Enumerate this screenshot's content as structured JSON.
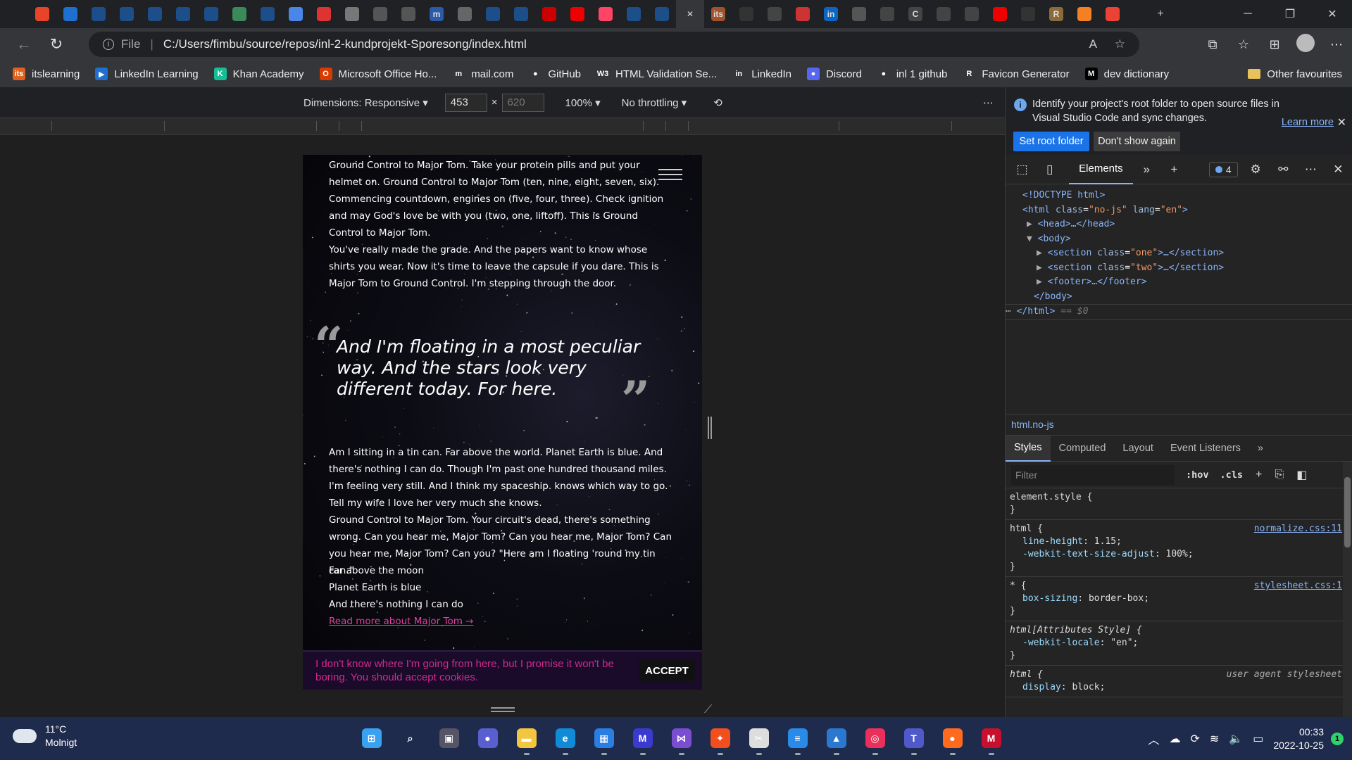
{
  "browser": {
    "tabs": [
      {
        "icon": "tab-actions-icon",
        "label": "",
        "color": "#202124"
      },
      {
        "icon": "office-icon",
        "label": "",
        "color": "#e8442a"
      },
      {
        "icon": "outlook-icon",
        "label": "",
        "color": "#1f6fd0"
      },
      {
        "icon": "video-icon",
        "label": "",
        "color": "#1c4e8a"
      },
      {
        "icon": "video-icon",
        "label": "",
        "color": "#1c4e8a"
      },
      {
        "icon": "video-icon",
        "label": "",
        "color": "#1c4e8a"
      },
      {
        "icon": "video-icon",
        "label": "",
        "color": "#1c4e8a"
      },
      {
        "icon": "video-icon",
        "label": "",
        "color": "#1c4e8a"
      },
      {
        "icon": "shield-icon",
        "label": "",
        "color": "#3a8a5a"
      },
      {
        "icon": "video-icon",
        "label": "",
        "color": "#1c4e8a"
      },
      {
        "icon": "docs-icon",
        "label": "",
        "color": "#4a86e8"
      },
      {
        "icon": "extension-icon",
        "label": "",
        "color": "#d33"
      },
      {
        "icon": "screenshot-icon",
        "label": "",
        "color": "#777"
      },
      {
        "icon": "extension-icon",
        "label": "",
        "color": "#555"
      },
      {
        "icon": "star-icon",
        "label": "",
        "color": "#555"
      },
      {
        "icon": "mail-icon",
        "label": "m",
        "color": "#2b5ba8"
      },
      {
        "icon": "circle-g-icon",
        "label": "",
        "color": "#666"
      },
      {
        "icon": "person-icon",
        "label": "",
        "color": "#1c4e8a"
      },
      {
        "icon": "person-icon",
        "label": "",
        "color": "#1c4e8a"
      },
      {
        "icon": "youtube-icon",
        "label": "",
        "color": "#c00"
      },
      {
        "icon": "youtube-icon",
        "label": "",
        "color": "#e00"
      },
      {
        "icon": "asterisk-icon",
        "label": "",
        "color": "#f46"
      },
      {
        "icon": "person-icon",
        "label": "",
        "color": "#1c4e8a"
      },
      {
        "icon": "video-icon",
        "label": "",
        "color": "#1c4e8a"
      },
      {
        "icon": "close-icon",
        "label": "",
        "color": "#35363a"
      },
      {
        "icon": "itslearning-icon",
        "label": "its",
        "color": "#a0522d"
      },
      {
        "icon": "github-icon",
        "label": "",
        "color": "#333"
      },
      {
        "icon": "vscode-icon",
        "label": "",
        "color": "#444"
      },
      {
        "icon": "pin-icon",
        "label": "",
        "color": "#c33"
      },
      {
        "icon": "linkedin-icon",
        "label": "in",
        "color": "#0a66c2"
      },
      {
        "icon": "file-icon",
        "label": "",
        "color": "#555"
      },
      {
        "icon": "camera-icon",
        "label": "",
        "color": "#444"
      },
      {
        "icon": "c-icon",
        "label": "C",
        "color": "#444"
      },
      {
        "icon": "vscode-icon",
        "label": "",
        "color": "#444"
      },
      {
        "icon": "code-icon",
        "label": "",
        "color": "#444"
      },
      {
        "icon": "youtube-icon",
        "label": "",
        "color": "#e00"
      },
      {
        "icon": "github-icon",
        "label": "",
        "color": "#333"
      },
      {
        "icon": "r-icon",
        "label": "R",
        "color": "#8b6b3a"
      },
      {
        "icon": "stack-icon",
        "label": "",
        "color": "#f48024"
      },
      {
        "icon": "chrome-icon",
        "label": "",
        "color": "#ea4335"
      }
    ],
    "address": {
      "file_label": "File",
      "url": "C:/Users/fimbu/source/repos/inl-2-kundprojekt-Sporesong/index.html"
    },
    "favourites": [
      {
        "label": "itslearning",
        "icon_text": "its",
        "color": "#e0611b"
      },
      {
        "label": "LinkedIn Learning",
        "icon_text": "▶",
        "color": "#1f6fd0"
      },
      {
        "label": "Khan Academy",
        "icon_text": "K",
        "color": "#14bf96"
      },
      {
        "label": "Microsoft Office Ho...",
        "icon_text": "O",
        "color": "#d83b01"
      },
      {
        "label": "mail.com",
        "icon_text": "m",
        "color": "#35363a"
      },
      {
        "label": "GitHub",
        "icon_text": "●",
        "color": "#35363a"
      },
      {
        "label": "HTML Validation Se...",
        "icon_text": "W3",
        "color": "#35363a"
      },
      {
        "label": "LinkedIn",
        "icon_text": "in",
        "color": "#35363a"
      },
      {
        "label": "Discord",
        "icon_text": "●",
        "color": "#5865f2"
      },
      {
        "label": "inl 1 github",
        "icon_text": "●",
        "color": "#35363a"
      },
      {
        "label": "Favicon Generator",
        "icon_text": "R",
        "color": "#35363a"
      },
      {
        "label": "dev dictionary",
        "icon_text": "M",
        "color": "#000000"
      }
    ],
    "other_favourites": "Other favourites"
  },
  "device_toolbar": {
    "dimensions_label": "Dimensions: Responsive",
    "width": "453",
    "height_placeholder": "620",
    "times": "×",
    "zoom": "100%",
    "throttling": "No throttling"
  },
  "page": {
    "paragraph1": "Ground Control to Major Tom. Take your protein pills and put your helmet on. Ground Control to Major Tom (ten, nine, eight, seven, six). Commencing countdown, engines on (five, four, three). Check ignition and may God's love be with you (two, one, liftoff). This is Ground Control to Major Tom.",
    "paragraph2": "You've really made the grade. And the papers want to know whose shirts you wear. Now it's time to leave the capsule if you dare. This is Major Tom to Ground Control. I'm stepping through the door.",
    "quote": "And I'm floating in a most peculiar way. And the stars look very different today. For here.",
    "open_quote": "“",
    "close_quote": "”",
    "paragraph3": "Am I sitting in a tin can. Far above the world. Planet Earth is blue. And there's nothing I can do. Though I'm past one hundred thousand miles. I'm feeling very still. And I think my spaceship. knows which way to go. Tell my wife I love her very much she knows.",
    "paragraph4": "Ground Control to Major Tom. Your circuit's dead, there's something wrong. Can you hear me, Major Tom? Can you hear me, Major Tom? Can you hear me, Major Tom? Can you? \"Here am I floating 'round my tin can.\"",
    "line1": "Far above the moon",
    "line2": "Planet Earth is blue",
    "line3": "And there's nothing I can do",
    "read_more": "Read more about Major Tom →",
    "cookie_text": "I don't know where I'm going from here, but I promise it won't be boring. You should accept cookies.",
    "accept_label": "ACCEPT"
  },
  "devtools": {
    "info_message": "Identify your project's root folder to open source files in Visual Studio Code and sync changes.",
    "learn_more": "Learn more",
    "set_root_label": "Set root folder",
    "dont_show_label": "Don't show again",
    "elements_tab": "Elements",
    "issues_count": "4",
    "dom": {
      "doctype": "<!DOCTYPE html>",
      "html_open_tag": "html",
      "html_class": "no-js",
      "html_lang": "en",
      "head": "<head>…</head>",
      "body_open": "<body>",
      "section_one_class": "one",
      "section_two_class": "two",
      "footer": "<footer>…</footer>",
      "body_close": "</body>",
      "html_close": "</html>",
      "selected_marker": "== $0"
    },
    "breadcrumb": "html.no-js",
    "sub_tabs": [
      "Styles",
      "Computed",
      "Layout",
      "Event Listeners"
    ],
    "filter_placeholder": "Filter",
    "hov_label": ":hov",
    "cls_label": ".cls",
    "rules": [
      {
        "selector": "element.style {",
        "source": "",
        "props": [],
        "close": "}"
      },
      {
        "selector": "html {",
        "source": "normalize.css:11",
        "props": [
          {
            "name": "line-height",
            "value": "1.15;"
          },
          {
            "name": "-webkit-text-size-adjust",
            "value": "100%;"
          }
        ],
        "close": "}"
      },
      {
        "selector": "* {",
        "source": "stylesheet.css:1",
        "props": [
          {
            "name": "box-sizing",
            "value": "border-box;"
          }
        ],
        "close": "}"
      },
      {
        "selector": "html[Attributes Style] {",
        "source": "",
        "props": [
          {
            "name": "-webkit-locale",
            "value": "\"en\";"
          }
        ],
        "close": "}"
      },
      {
        "selector": "html {",
        "source": "user agent stylesheet",
        "props": [
          {
            "name": "display",
            "value": "block;"
          }
        ],
        "close": ""
      }
    ]
  },
  "taskbar": {
    "temperature": "11°C",
    "weather": "Molnigt",
    "time": "00:33",
    "date": "2022-10-25",
    "notification_count": "1",
    "apps": [
      {
        "icon": "windows-start-icon",
        "color": "#3aa0f0",
        "label": "⊞"
      },
      {
        "icon": "search-icon",
        "color": "#1f2b4d",
        "label": "⌕"
      },
      {
        "icon": "task-view-icon",
        "color": "#556",
        "label": "▣"
      },
      {
        "icon": "teams-chat-icon",
        "color": "#5a5fcf",
        "label": "●"
      },
      {
        "icon": "file-explorer-icon",
        "color": "#f3c640",
        "label": "▬"
      },
      {
        "icon": "edge-icon",
        "color": "#0f8bd8",
        "label": "e"
      },
      {
        "icon": "store-icon",
        "color": "#2a7de1",
        "label": "▦"
      },
      {
        "icon": "vs-preview-icon",
        "color": "#3a3ad0",
        "label": "M"
      },
      {
        "icon": "visual-studio-icon",
        "color": "#7b4dd0",
        "label": "⋈"
      },
      {
        "icon": "figma-icon",
        "color": "#f24e1e",
        "label": "✦"
      },
      {
        "icon": "snipping-tool-icon",
        "color": "#ddd",
        "label": "✂"
      },
      {
        "icon": "notepad-icon",
        "color": "#2a8ae8",
        "label": "≡"
      },
      {
        "icon": "photos-icon",
        "color": "#2a78d0",
        "label": "▲"
      },
      {
        "icon": "creative-cloud-icon",
        "color": "#ea2f5a",
        "label": "◎"
      },
      {
        "icon": "teams-icon",
        "color": "#5059c9",
        "label": "T"
      },
      {
        "icon": "firefox-icon",
        "color": "#ff6a1f",
        "label": "●"
      },
      {
        "icon": "mcafee-icon",
        "color": "#c8102e",
        "label": "M"
      }
    ]
  }
}
